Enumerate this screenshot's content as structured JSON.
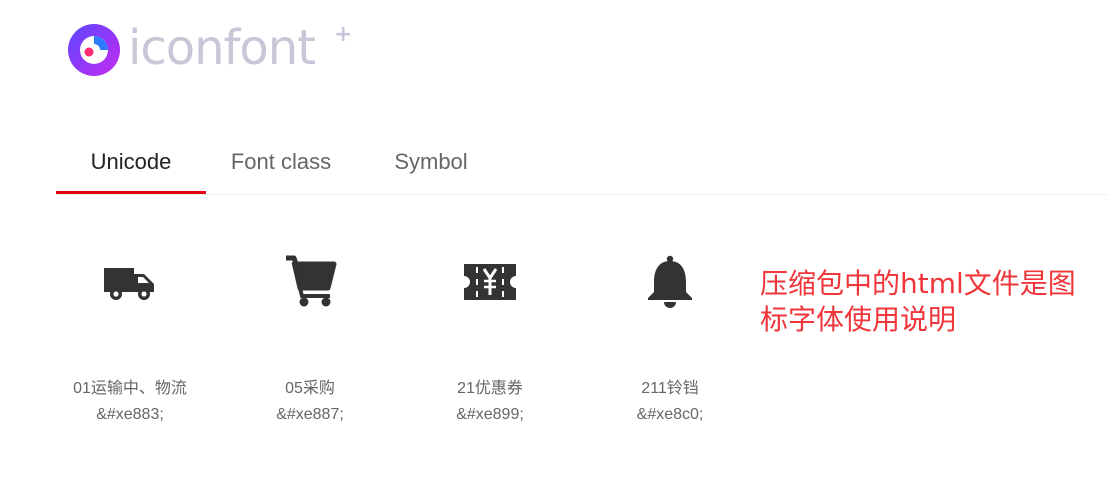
{
  "header": {
    "logo_text": "iconfont",
    "logo_plus": "+",
    "logo_icon": "iconfont-logo-icon",
    "brand_gradient": [
      "#6a3cff",
      "#c22cf3"
    ],
    "logo_text_color": "#c9c6d8"
  },
  "tabs": [
    {
      "label": "Unicode",
      "active": true
    },
    {
      "label": "Font class",
      "active": false
    },
    {
      "label": "Symbol",
      "active": false
    }
  ],
  "accent_color": "#e50012",
  "icons": [
    {
      "icon": "truck-icon",
      "name": "01运输中、物流",
      "code": "&#xe883;"
    },
    {
      "icon": "cart-icon",
      "name": "05采购",
      "code": "&#xe887;"
    },
    {
      "icon": "coupon-yen-icon",
      "name": "21优惠券",
      "code": "&#xe899;"
    },
    {
      "icon": "bell-icon",
      "name": "211铃铛",
      "code": "&#xe8c0;"
    }
  ],
  "note": {
    "text": "压缩包中的html文件是图标字体使用说明",
    "color": "#f0363a"
  }
}
